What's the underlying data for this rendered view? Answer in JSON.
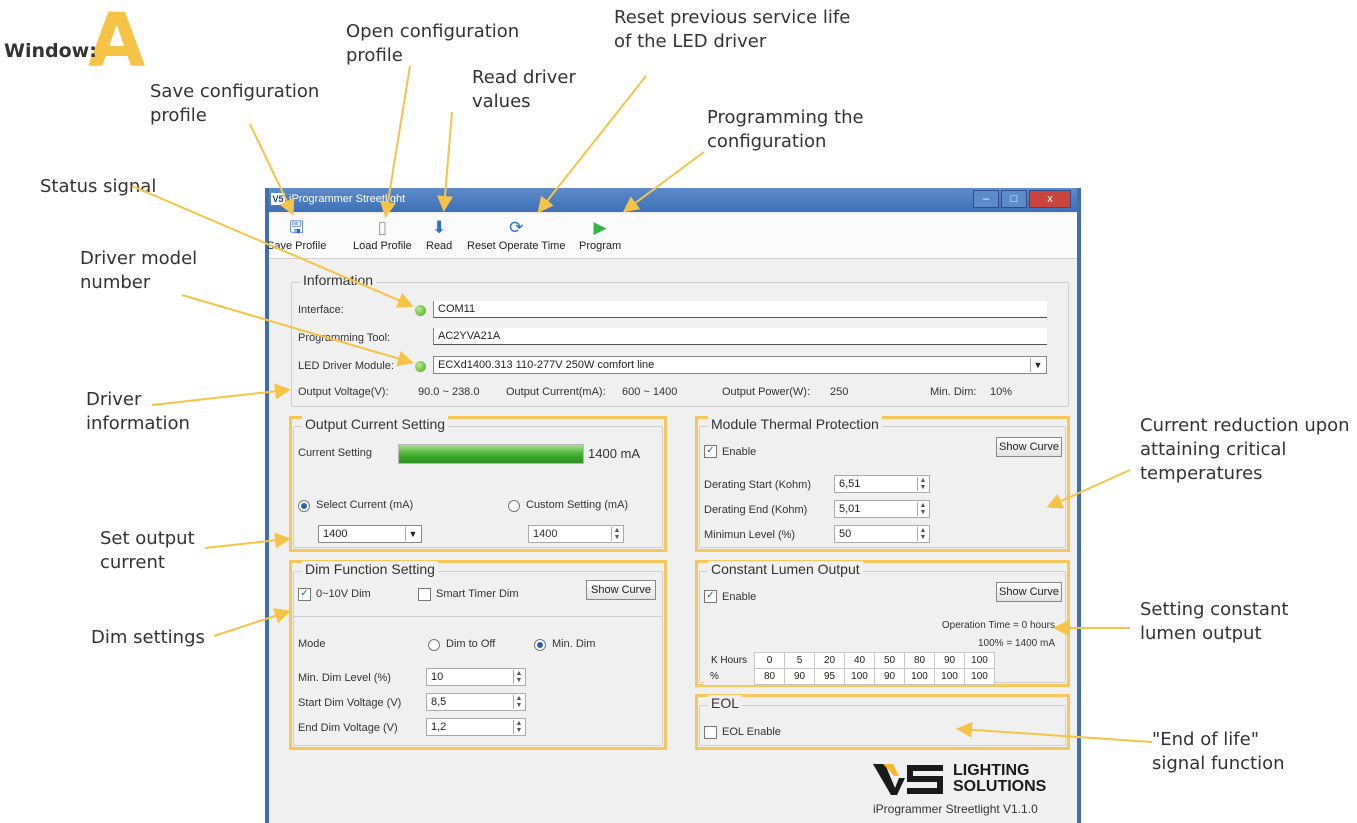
{
  "window_label": {
    "word": "Window:",
    "letter": "A"
  },
  "annotations": {
    "open_config": "Open configuration profile",
    "reset_life": "Reset previous service life of the LED driver",
    "read_values": "Read driver values",
    "save_config": "Save configuration profile",
    "programming": "Programming the configuration",
    "status_signal": "Status signal",
    "driver_model": "Driver model number",
    "driver_info": "Driver information",
    "set_output": "Set output current",
    "dim_settings": "Dim settings",
    "current_reduction": "Current reduction upon attaining critical temperatures",
    "constant_lumen": "Setting constant lumen output",
    "end_of_life": "\"End of life\" signal function"
  },
  "app": {
    "title": "iProgrammer Streetlight",
    "toolbar": {
      "save": "Save Profile",
      "load": "Load Profile",
      "read": "Read",
      "reset": "Reset Operate Time",
      "program": "Program"
    },
    "information": {
      "title": "Information",
      "interface_label": "Interface:",
      "interface_value": "COM11",
      "tool_label": "Programming Tool:",
      "tool_value": "AC2YVA21A",
      "module_label": "LED Driver Module:",
      "module_value": "ECXd1400.313 110-277V 250W comfort line",
      "voltage_label": "Output Voltage(V):",
      "voltage_value": "90.0 ~ 238.0",
      "current_label": "Output Current(mA):",
      "current_value": "600 ~ 1400",
      "power_label": "Output Power(W):",
      "power_value": "250",
      "mindim_label": "Min. Dim:",
      "mindim_value": "10%"
    },
    "output_current": {
      "title": "Output Current Setting",
      "current_setting_label": "Current Setting",
      "current_value": "1400 mA",
      "current_fraction": 1.0,
      "select_label": "Select Current (mA)",
      "select_value": "1400",
      "custom_label": "Custom Setting (mA)",
      "custom_value": "1400"
    },
    "thermal": {
      "title": "Module Thermal Protection",
      "enable": "Enable",
      "show_curve": "Show Curve",
      "start_label": "Derating Start (Kohm)",
      "start_value": "6,51",
      "end_label": "Derating End (Kohm)",
      "end_value": "5,01",
      "min_label": "Minimun Level (%)",
      "min_value": "50"
    },
    "dim": {
      "title": "Dim Function Setting",
      "dim_010": "0~10V Dim",
      "smart_timer": "Smart Timer Dim",
      "show_curve": "Show Curve",
      "mode_label": "Mode",
      "dim_to_off": "Dim to Off",
      "min_dim": "Min. Dim",
      "min_level_label": "Min. Dim Level (%)",
      "min_level_value": "10",
      "start_label": "Start Dim Voltage (V)",
      "start_value": "8,5",
      "end_label": "End Dim Voltage (V)",
      "end_value": "1,2"
    },
    "clo": {
      "title": "Constant Lumen Output",
      "enable": "Enable",
      "show_curve": "Show Curve",
      "operation_time": "Operation Time = 0 hours",
      "percent_line": "100% = 1400 mA",
      "row1_label": "K Hours",
      "row1": [
        "0",
        "5",
        "20",
        "40",
        "50",
        "80",
        "90",
        "100"
      ],
      "row2_label": "%",
      "row2": [
        "80",
        "90",
        "95",
        "100",
        "90",
        "100",
        "100",
        "100"
      ]
    },
    "eol": {
      "title": "EOL",
      "enable": "EOL Enable"
    },
    "footer": {
      "logo_line1": "LIGHTING",
      "logo_line2": "SOLUTIONS",
      "version": "iProgrammer Streetlight V1.1.0"
    }
  },
  "colors": {
    "accent": "#f7c75a",
    "status_green": "#46a51f",
    "titlebar": "#3e6fb5"
  }
}
